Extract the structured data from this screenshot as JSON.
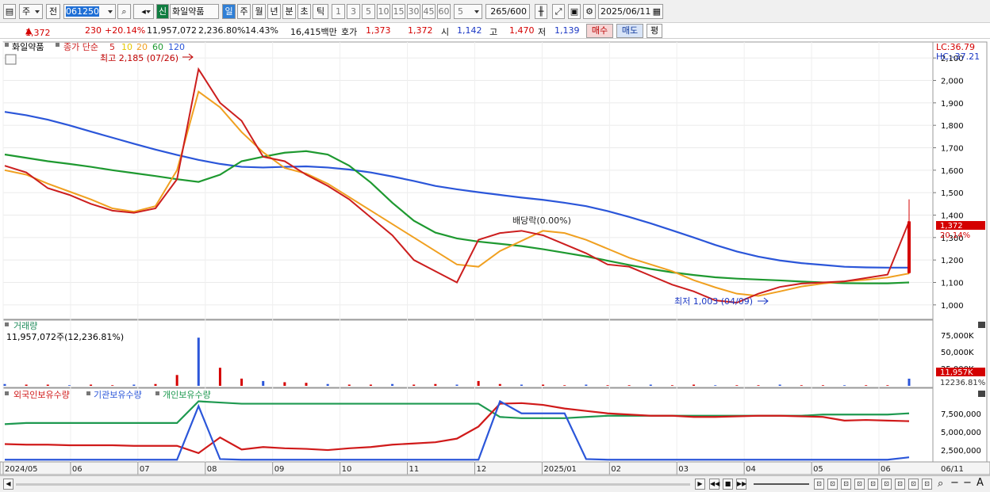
{
  "toolbar": {
    "period_select": "주",
    "prev_label": "전",
    "code": "061250",
    "stock_badge": "신",
    "stock_name": "화일약품",
    "period_tabs": [
      "일",
      "주",
      "월",
      "년",
      "분",
      "초",
      "틱"
    ],
    "interval_buttons": [
      "1",
      "3",
      "5",
      "10",
      "15",
      "30",
      "45",
      "60"
    ],
    "interval_select": "5",
    "bar_count": "265",
    "bar_total": "/600",
    "date": "2025/06/11"
  },
  "quote": {
    "price": "1,372",
    "change": "230",
    "change_pct": "+20.14%",
    "volume": "11,957,072",
    "volume_ratio": "2,236.80%",
    "turnover": "14.43%",
    "trade_value": "16,415백만",
    "ask_label": "호가",
    "ask_price": "1,373",
    "bid_price": "1,372",
    "open_label": "시",
    "open": "1,142",
    "high_label": "고",
    "high": "1,470",
    "low_label": "저",
    "low": "1,139",
    "buy_btn": "매수",
    "sell_btn": "매도",
    "eval_btn": "평"
  },
  "legend": {
    "stock_label": "화일약품",
    "ma_title": "종가 단순",
    "ma_periods": [
      "5",
      "10",
      "20",
      "60",
      "120"
    ],
    "ma_colors": [
      "#cc1e1e",
      "#ffe135",
      "#f0a020",
      "#1e9930",
      "#2b56d9"
    ],
    "lc": "LC:36.79",
    "hc": "HC:-37.21"
  },
  "annotations": {
    "high_note": "최고 2,185 (07/26)",
    "low_note": "최저 1,003 (04/09)",
    "dividend": "배당락(0.00%)",
    "last_price_tag": "1,372",
    "last_pct_tag": "20.14%"
  },
  "volume_panel": {
    "title": "거래량",
    "value": "11,957,072주(12,236.81%)",
    "axis": [
      "75,000K",
      "50,000K",
      "25,000K"
    ],
    "last_tag": "11,957K",
    "last_ratio_tag": "12236.81%"
  },
  "holdings_panel": {
    "series": [
      "외국인보유수량",
      "기관보유수량",
      "개인보유수량"
    ],
    "colors": [
      "#d01a1a",
      "#2b56d9",
      "#1e9950"
    ],
    "axis": [
      "7,500,000",
      "5,000,000",
      "2,500,000"
    ]
  },
  "x_axis": [
    "2024/05",
    "06",
    "07",
    "08",
    "09",
    "10",
    "11",
    "12",
    "2025/01",
    "02",
    "03",
    "04",
    "05",
    "06",
    "06/11"
  ],
  "chart_data": {
    "type": "line",
    "price_axis": [
      "2,100",
      "2,000",
      "1,900",
      "1,800",
      "1,700",
      "1,600",
      "1,500",
      "1,400",
      "1,300",
      "1,200",
      "1,100",
      "1,000"
    ],
    "ylim": [
      950,
      2150
    ],
    "ma120": [
      1860,
      1845,
      1825,
      1800,
      1772,
      1745,
      1718,
      1692,
      1668,
      1646,
      1628,
      1615,
      1612,
      1615,
      1617,
      1612,
      1603,
      1590,
      1572,
      1552,
      1530,
      1515,
      1502,
      1490,
      1478,
      1468,
      1455,
      1440,
      1418,
      1392,
      1363,
      1332,
      1300,
      1267,
      1238,
      1215,
      1198,
      1186,
      1178,
      1170,
      1167,
      1166,
      1166
    ],
    "ma60": [
      1670,
      1655,
      1640,
      1628,
      1615,
      1600,
      1587,
      1574,
      1560,
      1548,
      1580,
      1640,
      1660,
      1678,
      1685,
      1670,
      1620,
      1545,
      1455,
      1375,
      1322,
      1296,
      1282,
      1272,
      1262,
      1248,
      1232,
      1216,
      1197,
      1178,
      1160,
      1145,
      1133,
      1123,
      1117,
      1113,
      1109,
      1104,
      1100,
      1097,
      1096,
      1096,
      1100
    ],
    "ma20": [
      1600,
      1580,
      1540,
      1505,
      1470,
      1430,
      1415,
      1440,
      1600,
      1950,
      1880,
      1770,
      1680,
      1610,
      1585,
      1540,
      1480,
      1420,
      1360,
      1300,
      1240,
      1180,
      1170,
      1240,
      1285,
      1330,
      1320,
      1290,
      1250,
      1210,
      1180,
      1150,
      1110,
      1078,
      1050,
      1040,
      1060,
      1082,
      1095,
      1105,
      1112,
      1122,
      1140
    ],
    "ma5": [
      1620,
      1590,
      1520,
      1490,
      1450,
      1420,
      1410,
      1430,
      1560,
      2050,
      1900,
      1820,
      1660,
      1640,
      1580,
      1530,
      1470,
      1390,
      1310,
      1200,
      1150,
      1100,
      1290,
      1320,
      1330,
      1310,
      1270,
      1230,
      1180,
      1170,
      1130,
      1090,
      1060,
      1020,
      1010,
      1050,
      1080,
      1095,
      1100,
      1105,
      1120,
      1135,
      1372
    ],
    "volume": [
      3,
      2,
      2,
      1,
      2,
      1,
      2,
      3,
      18,
      80,
      30,
      12,
      8,
      6,
      5,
      3,
      2,
      2,
      3,
      2,
      3,
      2,
      8,
      3,
      2,
      2,
      1,
      2,
      1,
      1,
      2,
      1,
      2,
      1,
      1,
      1,
      2,
      1,
      1,
      1,
      1,
      1,
      11.9
    ],
    "foreign": [
      27,
      26,
      26,
      25,
      25,
      25,
      24,
      24,
      24,
      12,
      38,
      18,
      22,
      20,
      19,
      17,
      20,
      22,
      26,
      28,
      30,
      36,
      56,
      94,
      95,
      92,
      86,
      82,
      78,
      76,
      74,
      74,
      72,
      72,
      73,
      74,
      74,
      73,
      72,
      66,
      67,
      66,
      65
    ],
    "institution": [
      1,
      1,
      1,
      1,
      1,
      1,
      1,
      1,
      1,
      90,
      2,
      1,
      1,
      1,
      1,
      1,
      1,
      1,
      1,
      1,
      1,
      1,
      1,
      98,
      78,
      78,
      78,
      2,
      1,
      1,
      1,
      1,
      1,
      1,
      1,
      1,
      1,
      1,
      1,
      1,
      1,
      1,
      5
    ],
    "individual": [
      60,
      62,
      62,
      62,
      62,
      62,
      62,
      62,
      62,
      98,
      96,
      94,
      94,
      94,
      94,
      94,
      94,
      94,
      94,
      94,
      94,
      94,
      94,
      72,
      70,
      70,
      70,
      72,
      74,
      74,
      74,
      74,
      74,
      74,
      74,
      74,
      74,
      74,
      76,
      76,
      76,
      76,
      78
    ]
  }
}
